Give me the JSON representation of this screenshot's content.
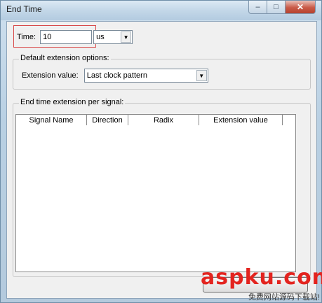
{
  "window": {
    "title": "End Time",
    "close_glyph": "✕",
    "minimize_glyph": "–",
    "maximize_glyph": "□"
  },
  "time": {
    "label": "Time:",
    "value": "10",
    "unit": "us"
  },
  "default_extension": {
    "group_title": "Default extension options:",
    "label": "Extension value:",
    "selected": "Last clock pattern"
  },
  "per_signal": {
    "group_title": "End time extension per signal:",
    "columns": [
      "Signal Name",
      "Direction",
      "Radix",
      "Extension value"
    ],
    "rows": []
  },
  "watermark": {
    "main": "aspku.com",
    "sub": "免费网站源码下载站!"
  },
  "colors": {
    "highlight": "#d84a4a",
    "watermark": "#e3241f"
  },
  "icons": {
    "dropdown": "chevron-down-icon",
    "close": "close-icon"
  }
}
